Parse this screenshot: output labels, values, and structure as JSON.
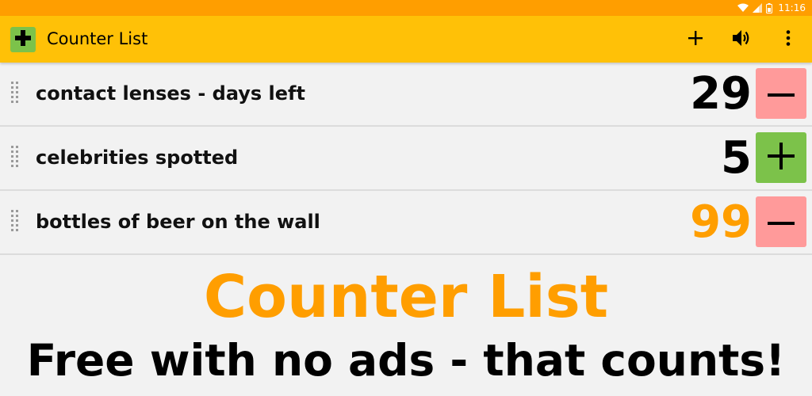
{
  "status_bar": {
    "time": "11:16",
    "icons": [
      "wifi-icon",
      "signal-icon",
      "battery-icon"
    ]
  },
  "app_bar": {
    "title": "Counter List",
    "logo_icon": "plus-icon",
    "actions": [
      {
        "name": "add-counter-button",
        "icon": "plus-icon"
      },
      {
        "name": "sound-button",
        "icon": "volume-icon"
      },
      {
        "name": "more-options-button",
        "icon": "more-vert-icon"
      }
    ]
  },
  "counters": [
    {
      "label": "contact lenses - days left",
      "value": "29",
      "value_color": "#000000",
      "action": "minus",
      "action_color": "#ff9a9a"
    },
    {
      "label": "celebrities spotted",
      "value": "5",
      "value_color": "#000000",
      "action": "plus",
      "action_color": "#7cc24a"
    },
    {
      "label": "bottles of beer on the wall",
      "value": "99",
      "value_color": "#ff9e00",
      "action": "minus",
      "action_color": "#ff9a9a"
    }
  ],
  "promo": {
    "title": "Counter List",
    "subtitle": "Free with no ads - that counts!"
  },
  "colors": {
    "status_bar": "#ff9e00",
    "app_bar": "#ffc107",
    "accent_orange": "#ff9e00",
    "minus_button": "#ff9a9a",
    "plus_button": "#7cc24a",
    "background": "#f2f2f2"
  }
}
